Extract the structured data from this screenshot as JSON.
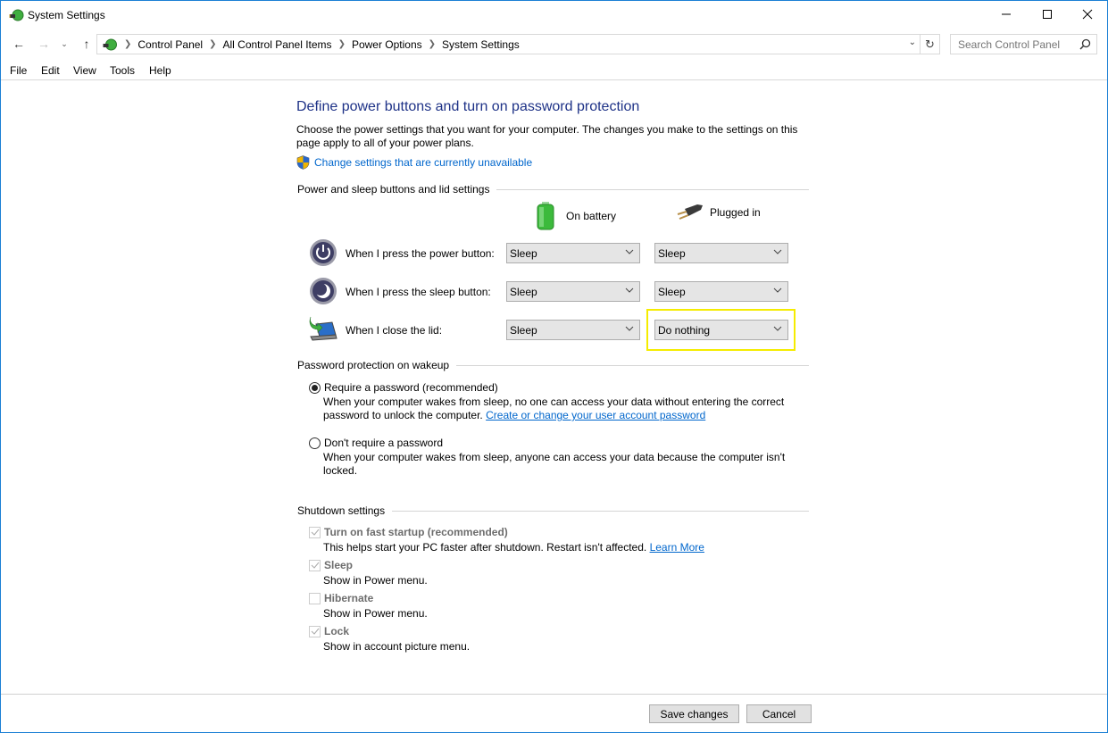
{
  "window": {
    "title": "System Settings",
    "controls": {
      "minimize": "minimize",
      "maximize": "maximize",
      "close": "close"
    }
  },
  "address_bar": {
    "breadcrumbs": [
      "Control Panel",
      "All Control Panel Items",
      "Power Options",
      "System Settings"
    ],
    "search_placeholder": "Search Control Panel"
  },
  "menu": [
    "File",
    "Edit",
    "View",
    "Tools",
    "Help"
  ],
  "page": {
    "title": "Define power buttons and turn on password protection",
    "description": "Choose the power settings that you want for your computer. The changes you make to the settings on this page apply to all of your power plans.",
    "uac_link": "Change settings that are currently unavailable"
  },
  "power_section": {
    "header": "Power and sleep buttons and lid settings",
    "columns": [
      "On battery",
      "Plugged in"
    ],
    "rows": [
      {
        "label": "When I press the power button:",
        "icon": "power-button-icon",
        "on_battery": "Sleep",
        "plugged_in": "Sleep"
      },
      {
        "label": "When I press the sleep button:",
        "icon": "sleep-button-icon",
        "on_battery": "Sleep",
        "plugged_in": "Sleep"
      },
      {
        "label": "When I close the lid:",
        "icon": "laptop-lid-icon",
        "on_battery": "Sleep",
        "plugged_in": "Do nothing"
      }
    ],
    "highlight_color": "#f5ec00"
  },
  "password_section": {
    "header": "Password protection on wakeup",
    "options": [
      {
        "label": "Require a password (recommended)",
        "selected": true,
        "desc": "When your computer wakes from sleep, no one can access your data without entering the correct password to unlock the computer.",
        "link": "Create or change your user account password"
      },
      {
        "label": "Don't require a password",
        "selected": false,
        "desc": "When your computer wakes from sleep, anyone can access your data because the computer isn't locked."
      }
    ]
  },
  "shutdown_section": {
    "header": "Shutdown settings",
    "items": [
      {
        "label": "Turn on fast startup (recommended)",
        "checked": true,
        "desc": "This helps start your PC faster after shutdown. Restart isn't affected.",
        "link": "Learn More"
      },
      {
        "label": "Sleep",
        "checked": true,
        "desc": "Show in Power menu."
      },
      {
        "label": "Hibernate",
        "checked": false,
        "desc": "Show in Power menu."
      },
      {
        "label": "Lock",
        "checked": true,
        "desc": "Show in account picture menu."
      }
    ]
  },
  "footer": {
    "save": "Save changes",
    "cancel": "Cancel"
  }
}
